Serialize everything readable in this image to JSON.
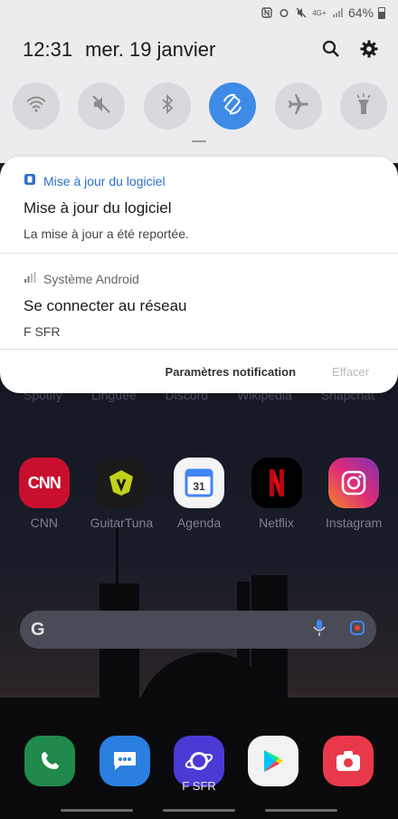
{
  "status_bar": {
    "battery": "64%",
    "network": "4G+"
  },
  "header": {
    "time": "12:31",
    "date": "mer. 19 janvier"
  },
  "quick_settings": [
    {
      "icon": "wifi-icon",
      "active": false
    },
    {
      "icon": "mute-icon",
      "active": false
    },
    {
      "icon": "bluetooth-icon",
      "active": false
    },
    {
      "icon": "auto-rotate-icon",
      "active": true
    },
    {
      "icon": "airplane-icon",
      "active": false
    },
    {
      "icon": "flashlight-icon",
      "active": false
    }
  ],
  "notifications": [
    {
      "app": "Mise à jour du logiciel",
      "title": "Mise à jour du logiciel",
      "body": "La mise à jour a été reportée."
    },
    {
      "app": "Système Android",
      "title": "Se connecter au réseau",
      "body": "F SFR"
    }
  ],
  "actions": {
    "settings": "Paramètres notification",
    "clear": "Effacer"
  },
  "hidden_labels": [
    "Spotify",
    "Linguee",
    "Discord",
    "Wikipedia",
    "Snapchat"
  ],
  "apps": [
    {
      "name": "CNN",
      "label": "CNN",
      "color": "#c8102e"
    },
    {
      "name": "GuitarTuna",
      "label": "GuitarTuna",
      "color": "#1a1a1a"
    },
    {
      "name": "Agenda",
      "label": "Agenda",
      "color": "#ffffff"
    },
    {
      "name": "Netflix",
      "label": "Netflix",
      "color": "#000000"
    },
    {
      "name": "Instagram",
      "label": "Instagram",
      "color": "#c13584"
    }
  ],
  "dock": [
    {
      "icon": "phone-icon",
      "color": "#1f8a4c"
    },
    {
      "icon": "messages-icon",
      "color": "#2a7fe0"
    },
    {
      "icon": "internet-icon",
      "color": "#3a3ad0"
    },
    {
      "icon": "play-store-icon",
      "color": "#f2f2f2"
    },
    {
      "icon": "camera-icon",
      "color": "#e8394a"
    }
  ],
  "carrier": "F SFR",
  "accent": "#3d8be6"
}
